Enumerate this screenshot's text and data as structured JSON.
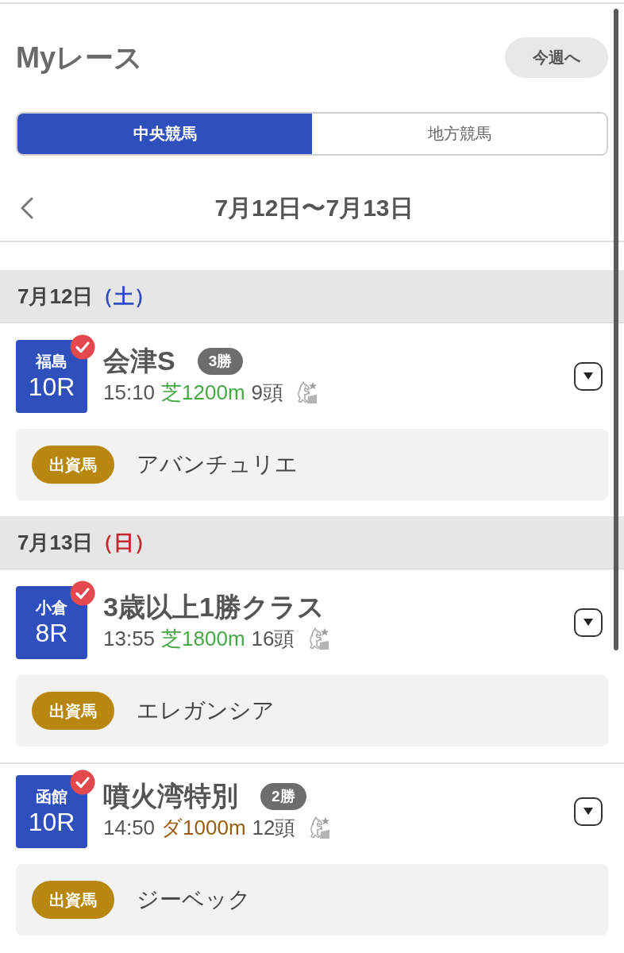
{
  "header": {
    "title": "Myレース",
    "this_week_button": "今週へ"
  },
  "tabs": [
    {
      "label": "中央競馬",
      "selected": true
    },
    {
      "label": "地方競馬",
      "selected": false
    }
  ],
  "date_nav": {
    "range": "7月12日〜7月13日"
  },
  "days": [
    {
      "date": "7月12日",
      "weekday": {
        "text": "（土）",
        "color": "#2e4fbd"
      },
      "races": [
        {
          "venue": "福島",
          "race_number": "10R",
          "checked": true,
          "name": "会津S",
          "grade": "3勝",
          "time": "15:10",
          "course": {
            "text": "芝1200m",
            "color": "#45a845"
          },
          "runners": "9頭",
          "horse": {
            "tag": "出資馬",
            "name": "アバンチュリエ"
          }
        }
      ]
    },
    {
      "date": "7月13日",
      "weekday": {
        "text": "（日）",
        "color": "#c02a2e"
      },
      "races": [
        {
          "venue": "小倉",
          "race_number": "8R",
          "checked": true,
          "name": "3歳以上1勝クラス",
          "time": "13:55",
          "course": {
            "text": "芝1800m",
            "color": "#45a845"
          },
          "runners": "16頭",
          "horse": {
            "tag": "出資馬",
            "name": "エレガンシア"
          }
        },
        {
          "venue": "函館",
          "race_number": "10R",
          "checked": true,
          "name": "噴火湾特別",
          "grade": "2勝",
          "time": "14:50",
          "course": {
            "text": "ダ1000m",
            "color": "#9a5c10"
          },
          "runners": "12頭",
          "horse": {
            "tag": "出資馬",
            "name": "ジーベック"
          }
        }
      ]
    }
  ]
}
